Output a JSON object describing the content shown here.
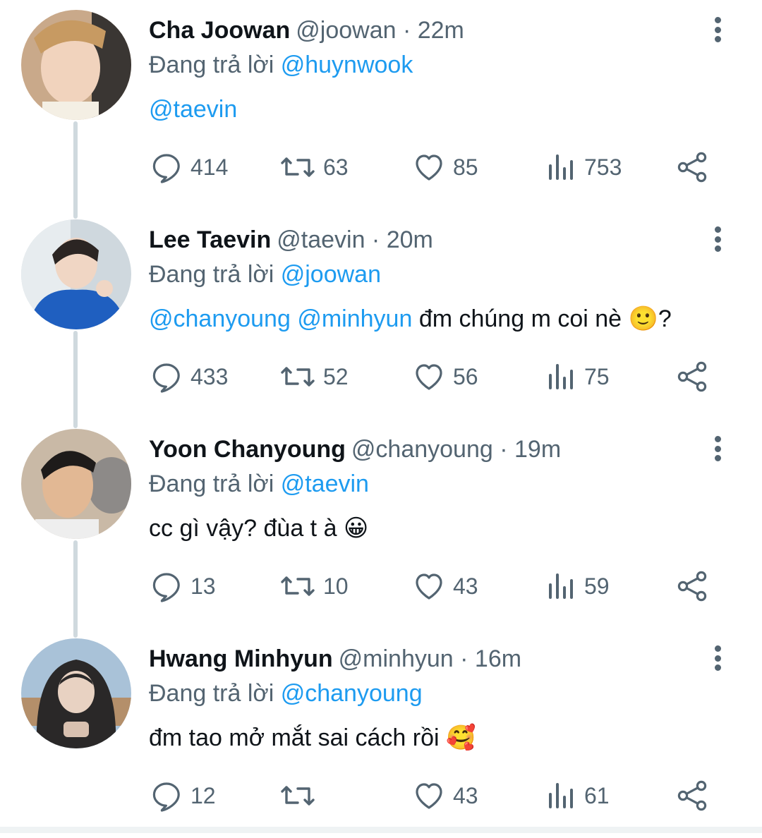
{
  "reply_prefix": "Đang trả lời",
  "tweets": [
    {
      "name": "Cha Joowan",
      "handle": "@joowan",
      "time": "22m",
      "reply_to": "@huynwook",
      "body_mentions": "@taevin",
      "body_text": "",
      "replies": "414",
      "retweets": "63",
      "likes": "85",
      "views": "753"
    },
    {
      "name": "Lee Taevin",
      "handle": "@taevin",
      "time": "20m",
      "reply_to": "@joowan",
      "body_mentions": "@chanyoung @minhyun",
      "body_text": "đm chúng m coi nè 🙂?",
      "replies": "433",
      "retweets": "52",
      "likes": "56",
      "views": "75"
    },
    {
      "name": "Yoon Chanyoung",
      "handle": "@chanyoung",
      "time": "19m",
      "reply_to": "@taevin",
      "body_mentions": "",
      "body_text": "cc gì vậy? đùa t à 😀",
      "replies": "13",
      "retweets": "10",
      "likes": "43",
      "views": "59"
    },
    {
      "name": "Hwang Minhyun",
      "handle": "@minhyun",
      "time": "16m",
      "reply_to": "@chanyoung",
      "body_mentions": "",
      "body_text": "đm tao mở mắt sai cách rồi 🥰",
      "replies": "12",
      "retweets": "",
      "likes": "43",
      "views": "61"
    }
  ],
  "colors": {
    "text": "#0f1419",
    "secondary": "#536471",
    "accent": "#1d9bf0",
    "thread_line": "#cfd9de"
  },
  "icons": [
    "reply-icon",
    "retweet-icon",
    "like-icon",
    "views-icon",
    "share-icon",
    "more-icon"
  ]
}
